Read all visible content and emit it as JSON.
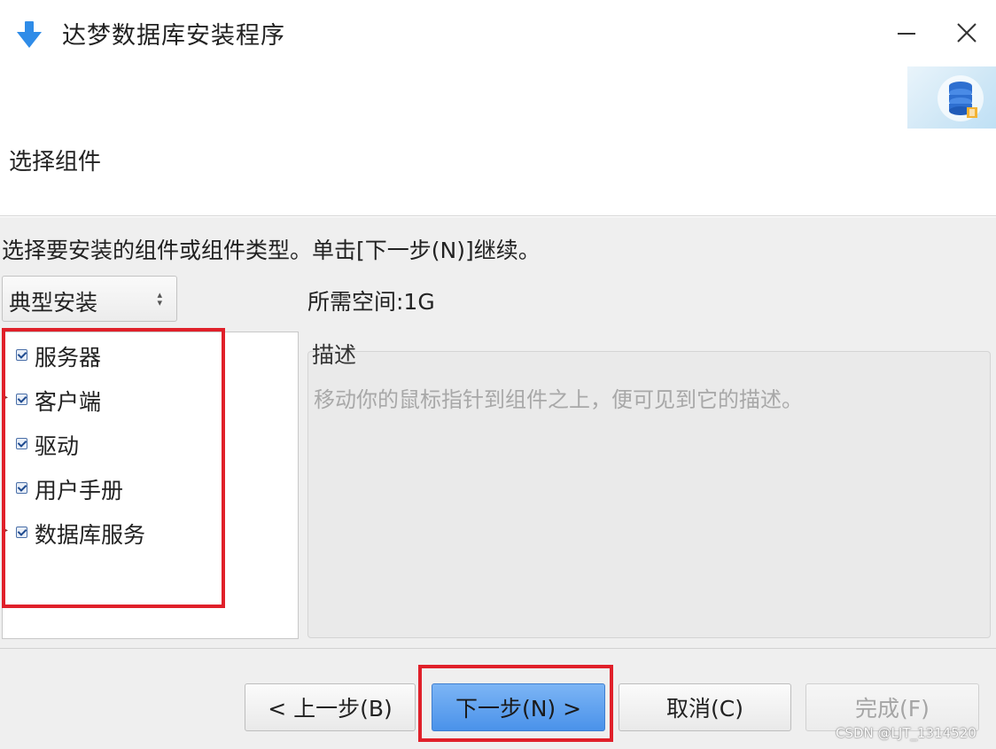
{
  "window": {
    "title": "达梦数据库安装程序",
    "icon": "download-arrow-icon",
    "minimize_icon": "minimize-icon",
    "close_icon": "close-icon"
  },
  "header": {
    "page_title": "选择组件",
    "logo": "database-logo-icon"
  },
  "main": {
    "instruction": "选择要安装的组件或组件类型。单击[下一步(N)]继续。",
    "install_type": {
      "selected": "典型安装"
    },
    "required_space": "所需空间:1G",
    "components": [
      {
        "label": "服务器",
        "checked": true,
        "expandable": false
      },
      {
        "label": "客户端",
        "checked": true,
        "expandable": true
      },
      {
        "label": "驱动",
        "checked": true,
        "expandable": false
      },
      {
        "label": "用户手册",
        "checked": true,
        "expandable": false
      },
      {
        "label": "数据库服务",
        "checked": true,
        "expandable": true
      }
    ],
    "description": {
      "legend": "描述",
      "text": "移动你的鼠标指针到组件之上，便可见到它的描述。"
    }
  },
  "footer": {
    "prev_label": "< 上一步(B)",
    "next_label": "下一步(N) >",
    "cancel_label": "取消(C)",
    "finish_label": "完成(F)"
  },
  "watermark": "CSDN @LJT_1314520",
  "colors": {
    "highlight": "#e0202a",
    "primary_button": "#5a9ff0"
  }
}
